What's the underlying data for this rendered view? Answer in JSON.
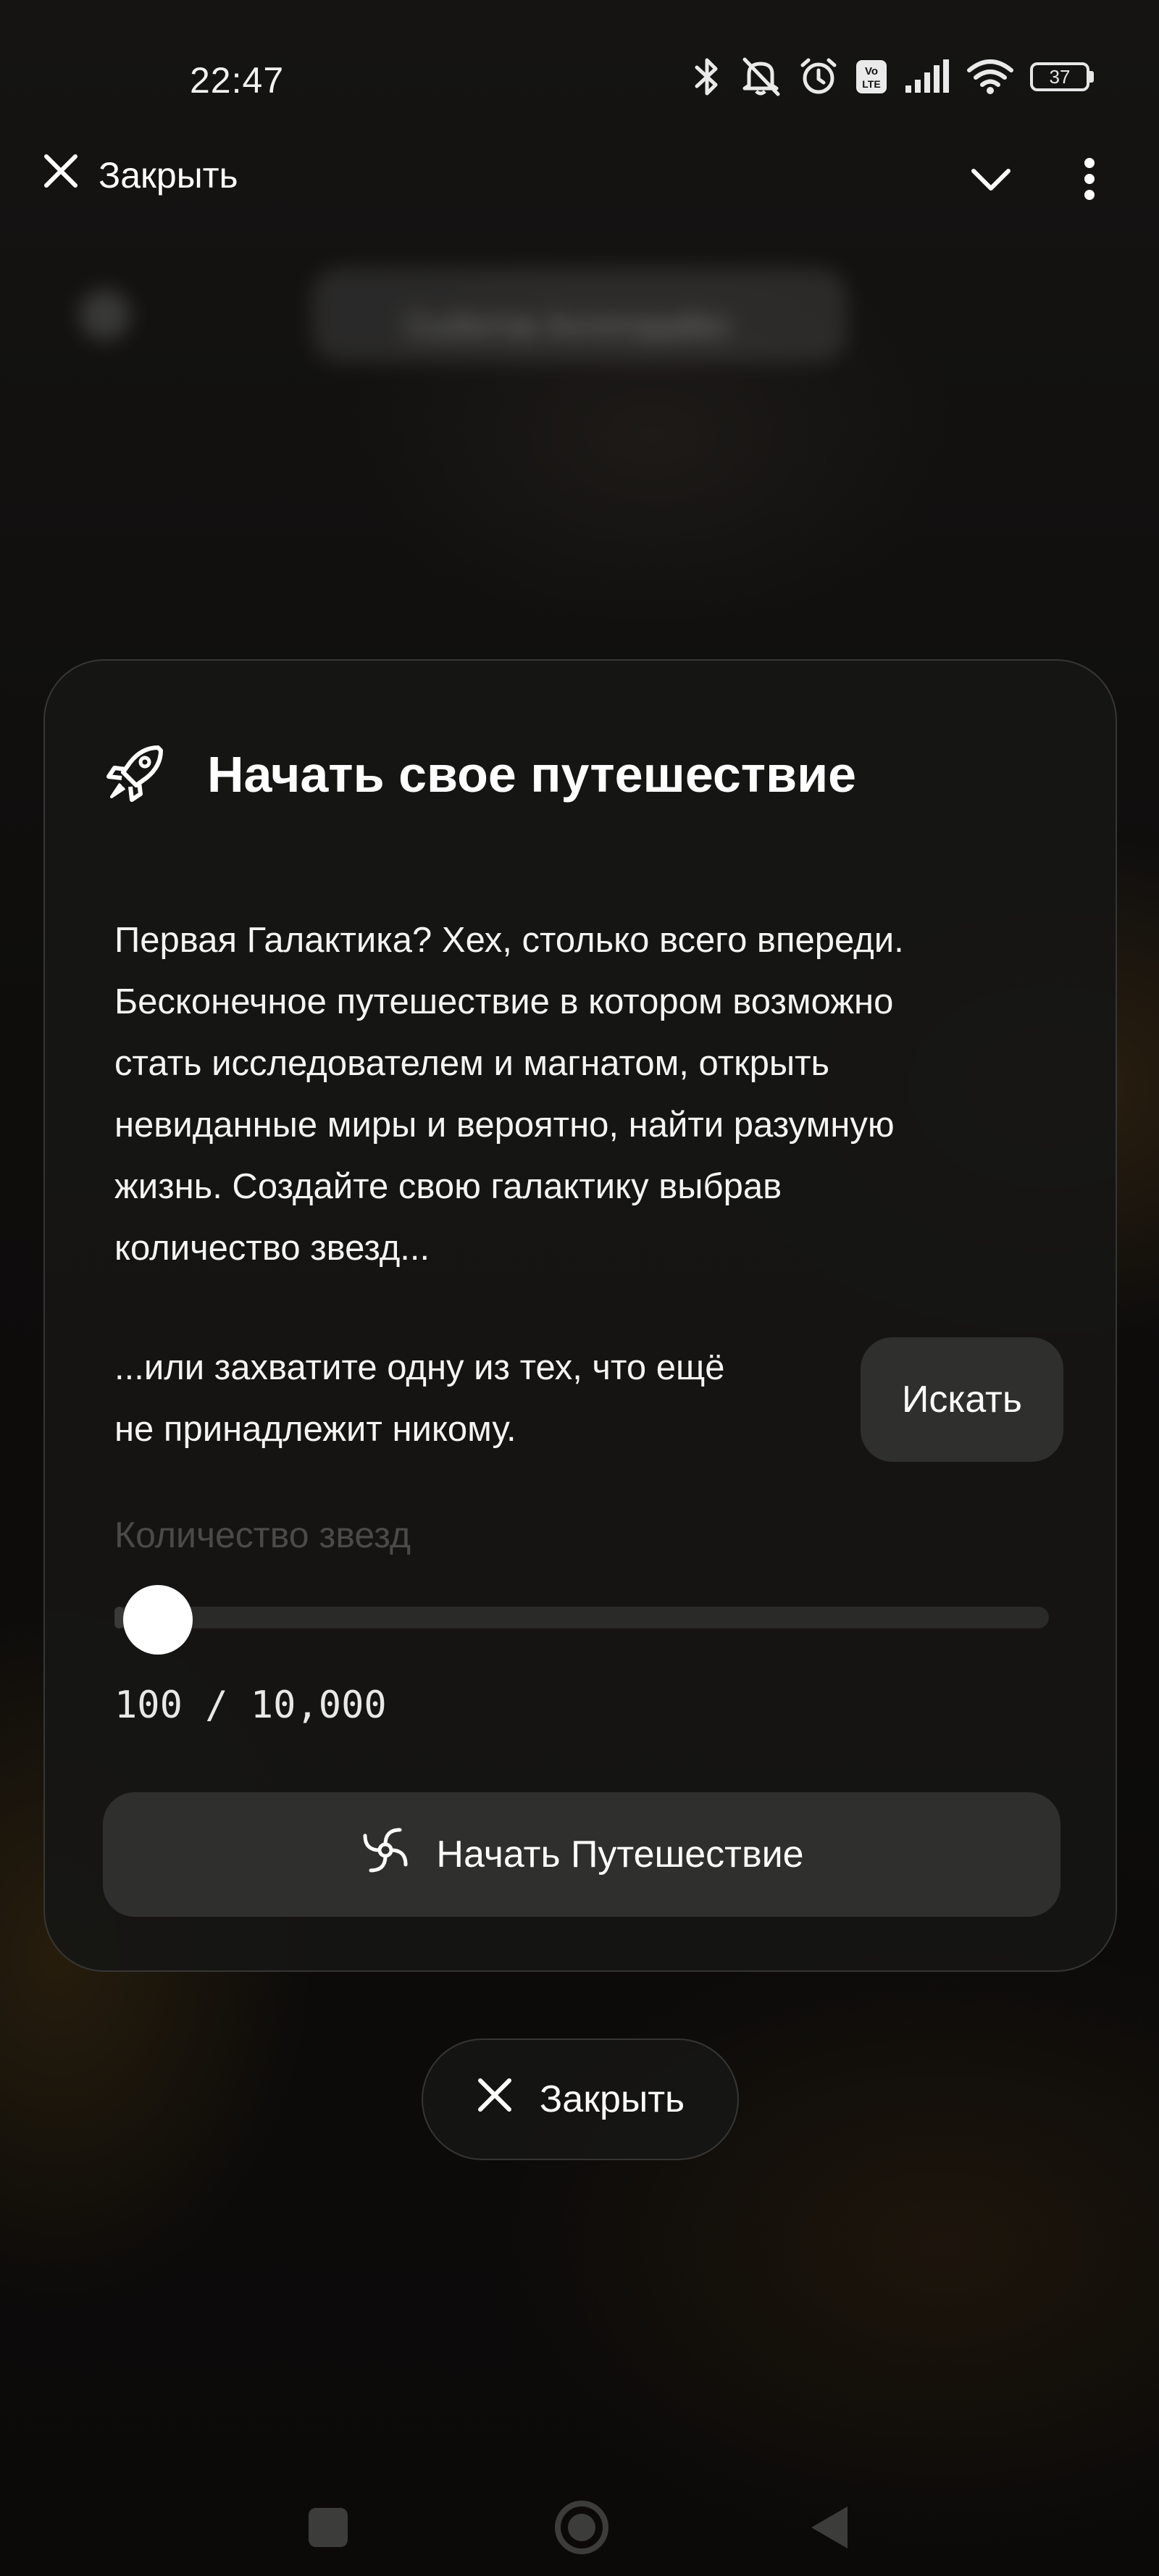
{
  "status_bar": {
    "time": "22:47",
    "battery": "37",
    "icons": [
      "bluetooth-icon",
      "bell-off-icon",
      "alarm-icon",
      "volte-icon",
      "signal-icon",
      "wifi-icon",
      "battery-icon"
    ]
  },
  "top_bar": {
    "close_label": "Закрыть",
    "icons": [
      "close-icon",
      "chevron-down-icon",
      "more-vertical-icon"
    ]
  },
  "background": {
    "blurred_text": "Сыбитов Aнтитоpaйог"
  },
  "card": {
    "icon": "rocket-icon",
    "title": "Начать свое путешествие",
    "intro_lines": [
      "Первая Галактика? Хех, столько всего впереди.",
      "Бесконечное путешествие в котором возможно",
      "стать исследователем и магнатом, открыть",
      "невиданные миры и вероятно, найти разумную",
      "жизнь. Создайте свою галактику выбрав",
      "количество звезд..."
    ],
    "alt_lines": [
      "...или захватите одну из тех, что ещё",
      "не принадлежит никому."
    ],
    "search_label": "Искать",
    "slider": {
      "label": "Количество звезд",
      "value": 100,
      "max": 10000,
      "value_text": "100 / 10,000"
    },
    "start_button": {
      "icon": "spiral-galaxy-icon",
      "label": "Начать Путешествие"
    }
  },
  "bottom_close": {
    "icon": "close-icon",
    "label": "Закрыть"
  },
  "nav_bar": {
    "icons": [
      "recents-square-icon",
      "home-circle-icon",
      "back-triangle-icon"
    ]
  },
  "colors": {
    "card_background": "#161615",
    "button_background": "#2f2f2d",
    "muted_label": "#4a4a48",
    "slider_track": "#2a2a28"
  }
}
